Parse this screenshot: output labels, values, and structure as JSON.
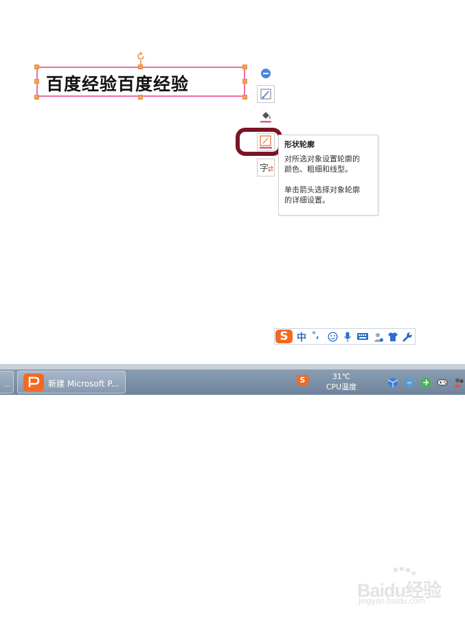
{
  "slide": {
    "textbox_text": "百度经验百度经验"
  },
  "side_toolbar": {
    "buttons": [
      "minus-icon",
      "shape-style-icon",
      "fill-icon",
      "shape-outline-icon",
      "text-format-icon"
    ],
    "char_label": "字"
  },
  "tooltip": {
    "title": "形状轮廓",
    "line1": "对所选对象设置轮廓的",
    "line2": "颜色、粗细和线型。",
    "line3": "单击箭头选择对象轮廓",
    "line4": "的详细设置。"
  },
  "ime": {
    "logo": "S",
    "mode": "中",
    "punct": "°,",
    "icons": [
      "smiley-icon",
      "mic-icon",
      "keyboard-icon",
      "user-icon",
      "shirt-icon",
      "wrench-icon"
    ]
  },
  "taskbar": {
    "left_item": "...",
    "task_label": "新建 Microsoft P...",
    "tray_logo": "S",
    "temperature": "31℃",
    "temperature_label": "CPU温度"
  },
  "watermark": {
    "main": "Baidu经验",
    "sub": "jingyan.baidu.com"
  },
  "colors": {
    "textbox_border": "#f06aa6",
    "handle": "#f3a25a",
    "highlight": "#7a1426",
    "sogou_orange": "#f26a21",
    "accent_blue": "#4c86d6"
  }
}
